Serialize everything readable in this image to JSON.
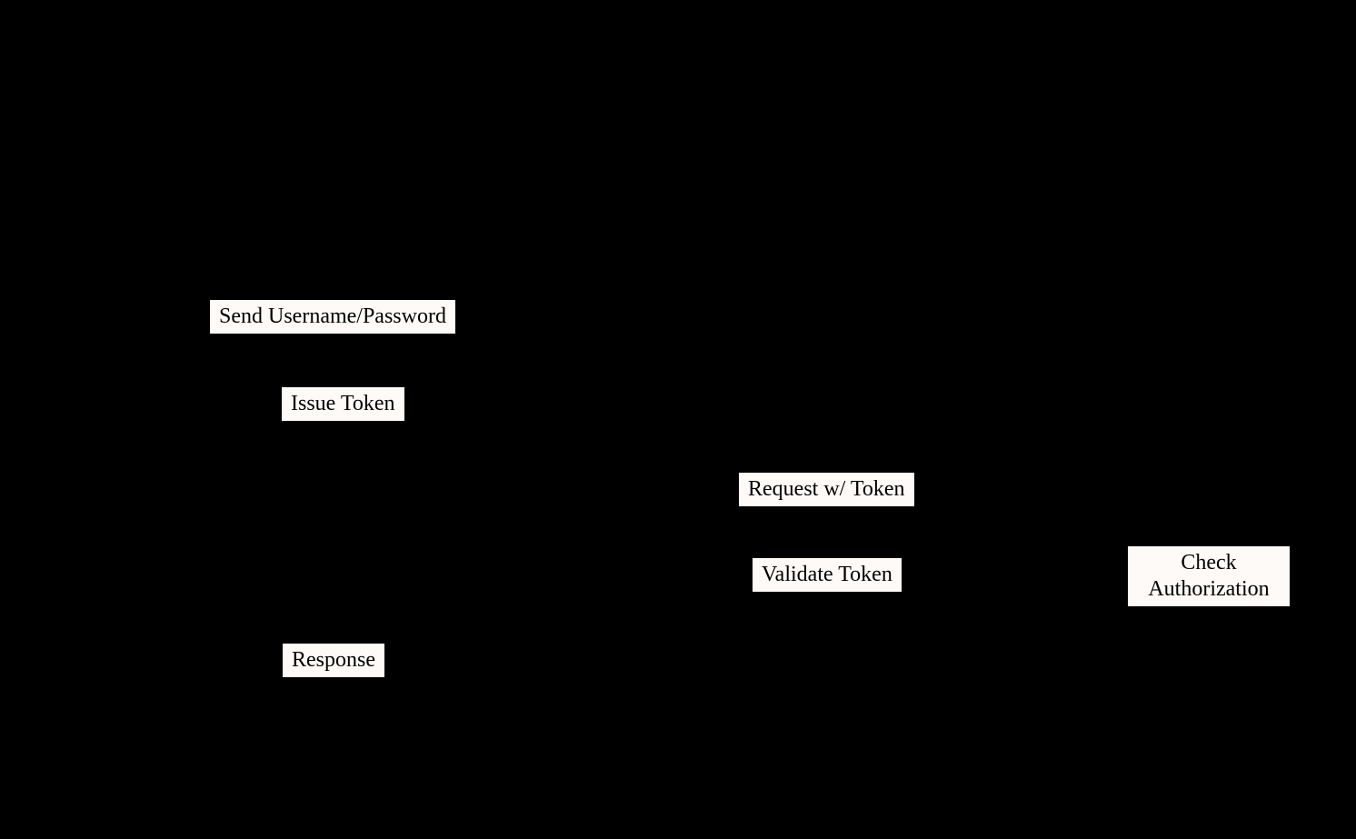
{
  "labels": {
    "send_credentials": "Send Username/Password",
    "issue_token": "Issue Token",
    "request_token": "Request w/ Token",
    "validate_token": "Validate Token",
    "check_authorization": "Check\nAuthorization",
    "response": "Response"
  }
}
